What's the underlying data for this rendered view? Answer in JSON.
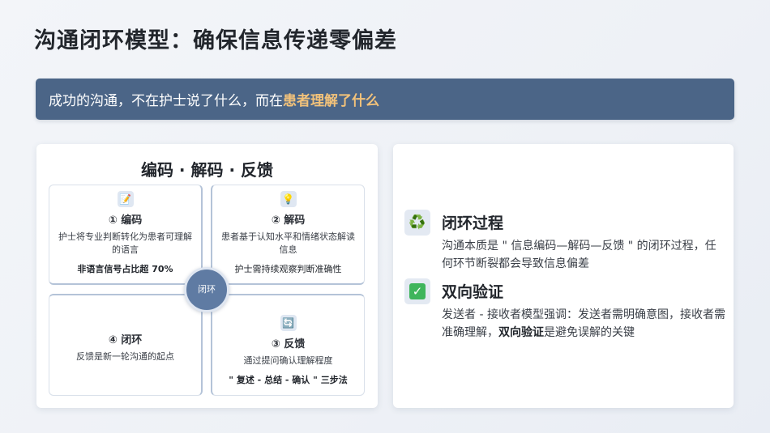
{
  "title": "沟通闭环模型：确保信息传递零偏差",
  "banner": {
    "prefix": "成功的沟通，不在护士说了什么，而在",
    "highlight": "患者理解了什么"
  },
  "model": {
    "heading": "编码 · 解码 · 反馈",
    "hub_label": "闭环",
    "quadrants": [
      {
        "icon": "memo-icon",
        "title": "① 编码",
        "text": "护士将专业判断转化为患者可理解的语言",
        "note": "非语言信号占比超 70%"
      },
      {
        "icon": "lightbulb-icon",
        "title": "② 解码",
        "text": "患者基于认知水平和情绪状态解读信息",
        "note": "护士需持续观察判断准确性"
      },
      {
        "icon": "",
        "title": "④ 闭环",
        "text": "反馈是新一轮沟通的起点",
        "note": ""
      },
      {
        "icon": "refresh-icon",
        "title": "③ 反馈",
        "text": "通过提问确认理解程度",
        "note": "\" 复述 - 总结 - 确认 \" 三步法"
      }
    ]
  },
  "items": [
    {
      "icon": "recycle-icon",
      "title": "闭环过程",
      "text": "沟通本质是 \" 信息编码—解码—反馈 \" 的闭环过程，任何环节断裂都会导致信息偏差"
    },
    {
      "icon": "check-icon",
      "title": "双向验证",
      "text_before": "发送者 - 接收者模型强调：发送者需明确意图，接收者需准确理解，",
      "text_bold": "双向验证",
      "text_after": "是避免误解的关键"
    }
  ],
  "colors": {
    "banner_bg": "#4b6587",
    "highlight": "#f2c27a",
    "hub": "#5f7ba3",
    "check": "#3fb55c"
  }
}
